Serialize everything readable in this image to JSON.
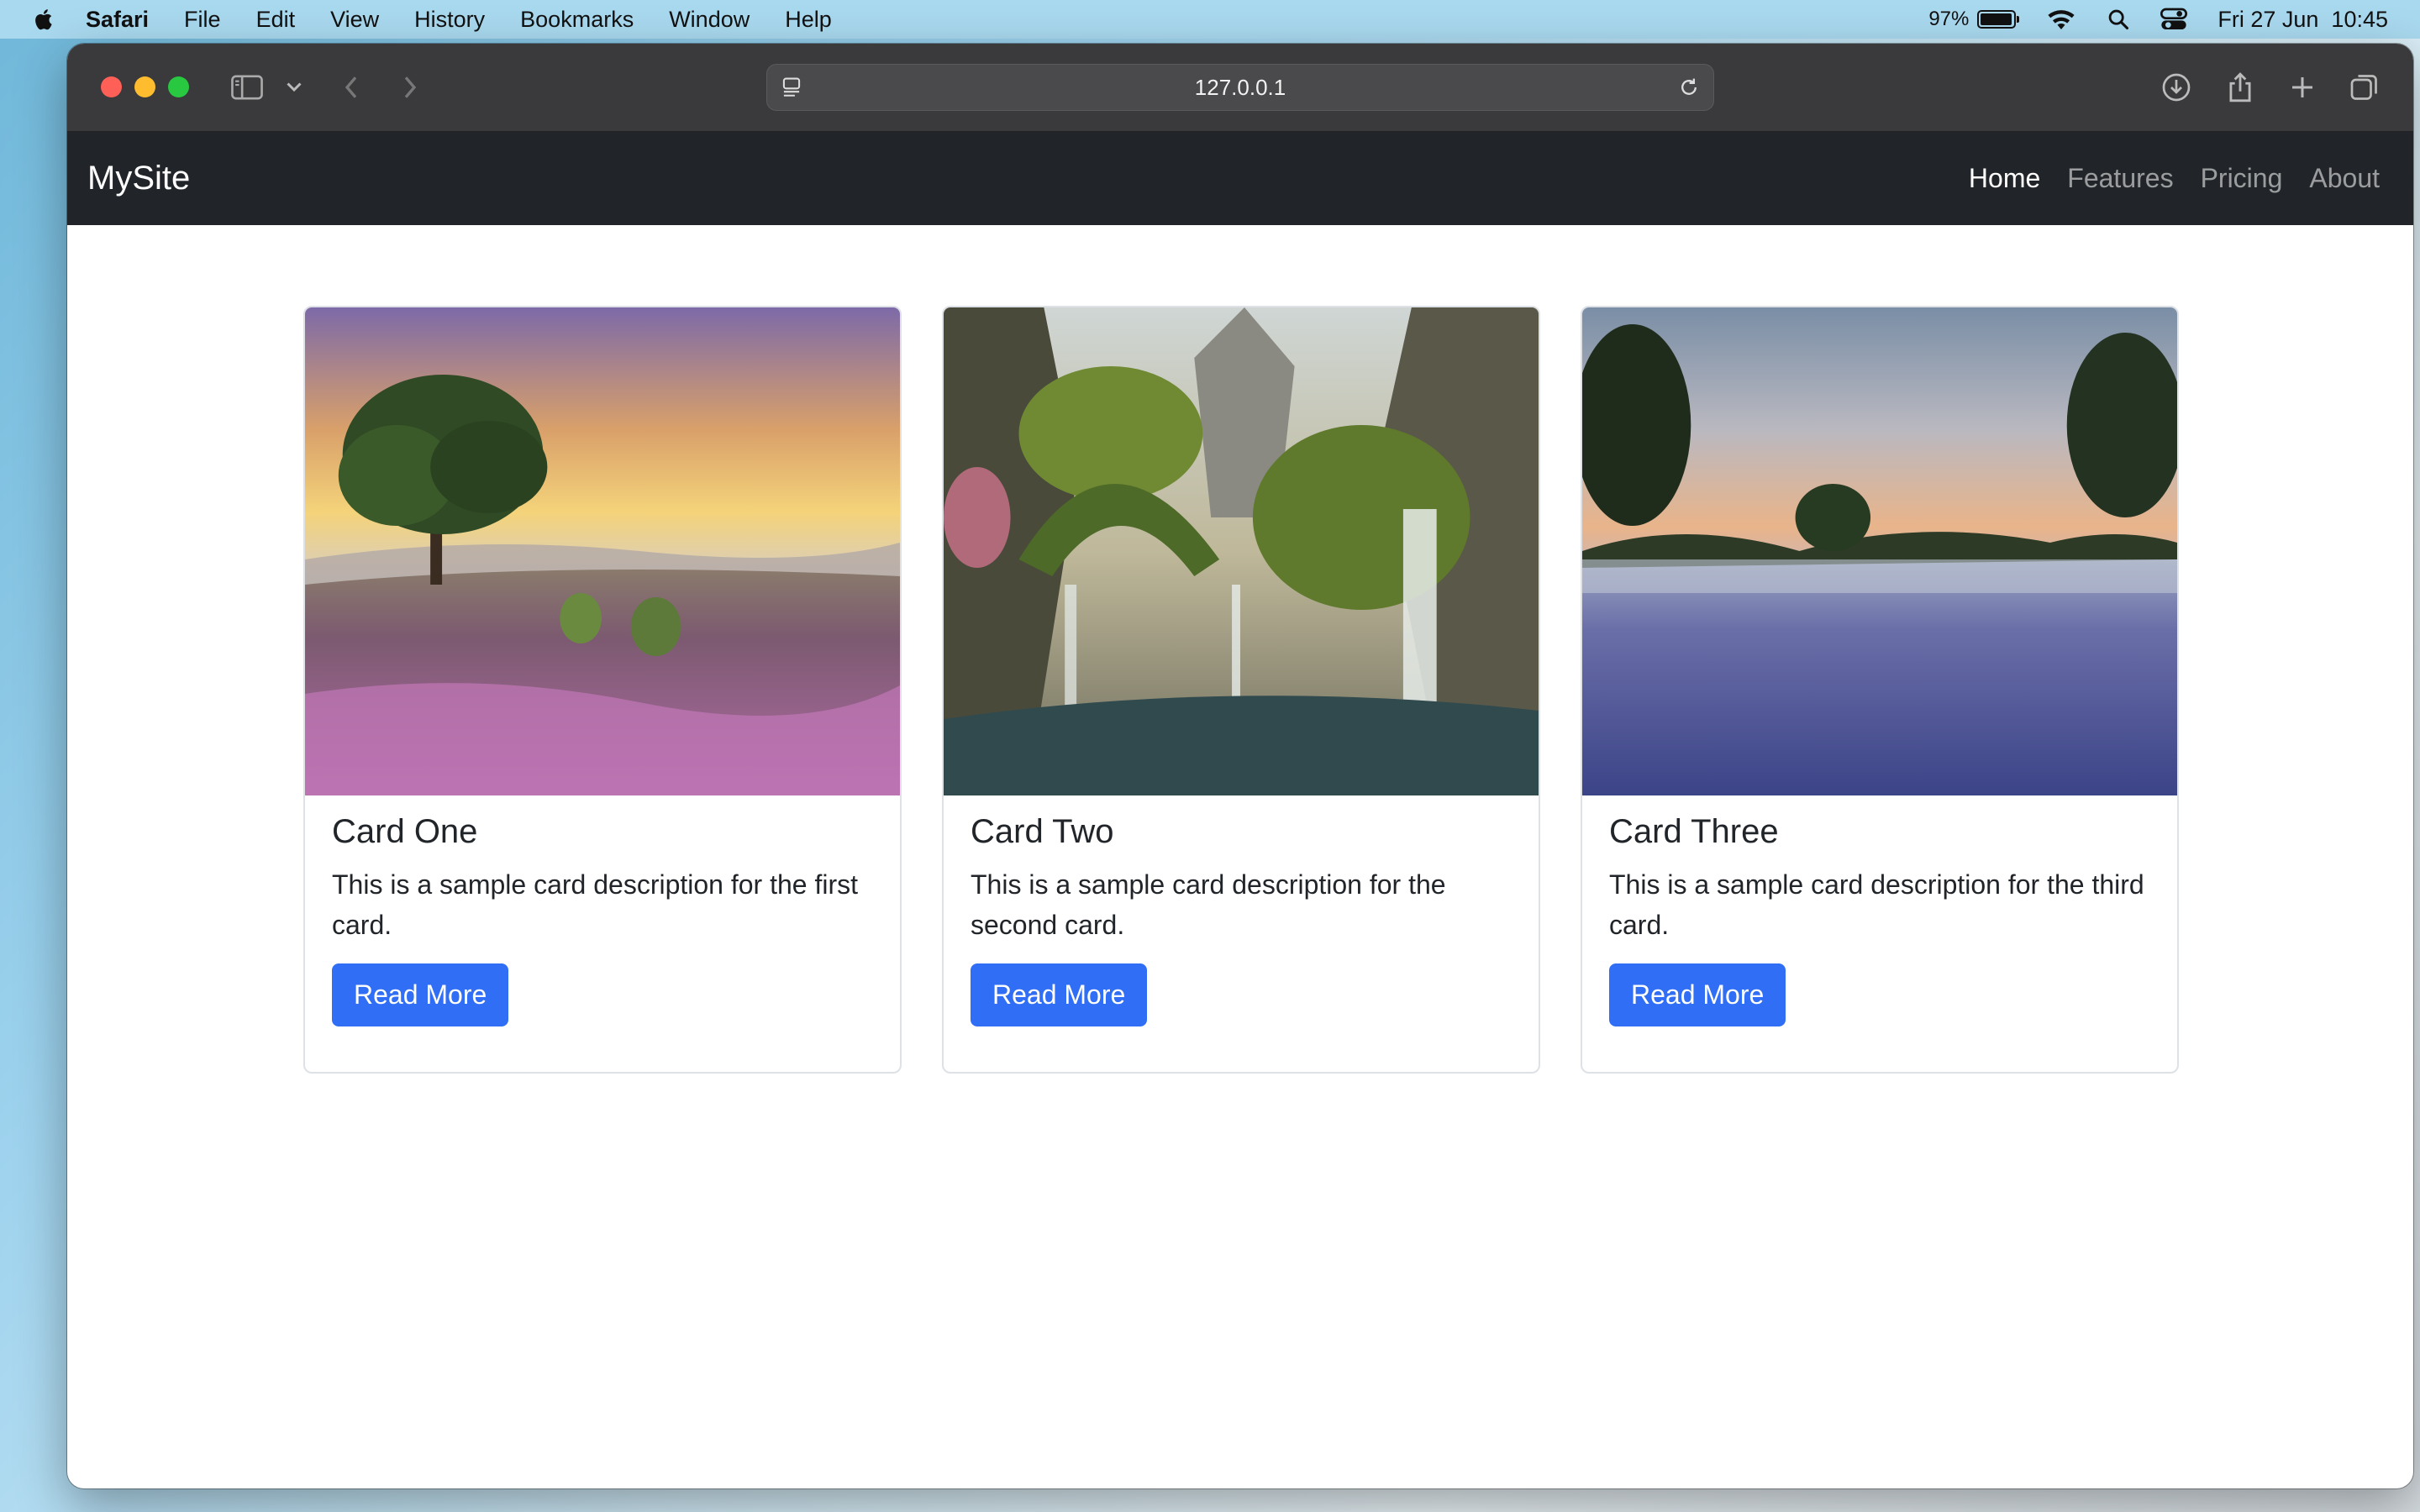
{
  "menubar": {
    "app": "Safari",
    "items": [
      "File",
      "Edit",
      "View",
      "History",
      "Bookmarks",
      "Window",
      "Help"
    ],
    "battery_percent": "97%",
    "battery_level": 0.97,
    "datetime": "Fri 27 Jun  10:45"
  },
  "browser": {
    "url": "127.0.0.1"
  },
  "site": {
    "brand": "MySite",
    "nav": [
      "Home",
      "Features",
      "Pricing",
      "About"
    ],
    "active_nav": "Home",
    "cards": [
      {
        "title": "Card One",
        "text": "This is a sample card description for the first card.",
        "button": "Read More"
      },
      {
        "title": "Card Two",
        "text": "This is a sample card description for the second card.",
        "button": "Read More"
      },
      {
        "title": "Card Three",
        "text": "This is a sample card description for the third card.",
        "button": "Read More"
      }
    ]
  },
  "colors": {
    "navbar": "#212529",
    "button": "#2f6ef5",
    "toolbar": "#3a3a3c"
  }
}
